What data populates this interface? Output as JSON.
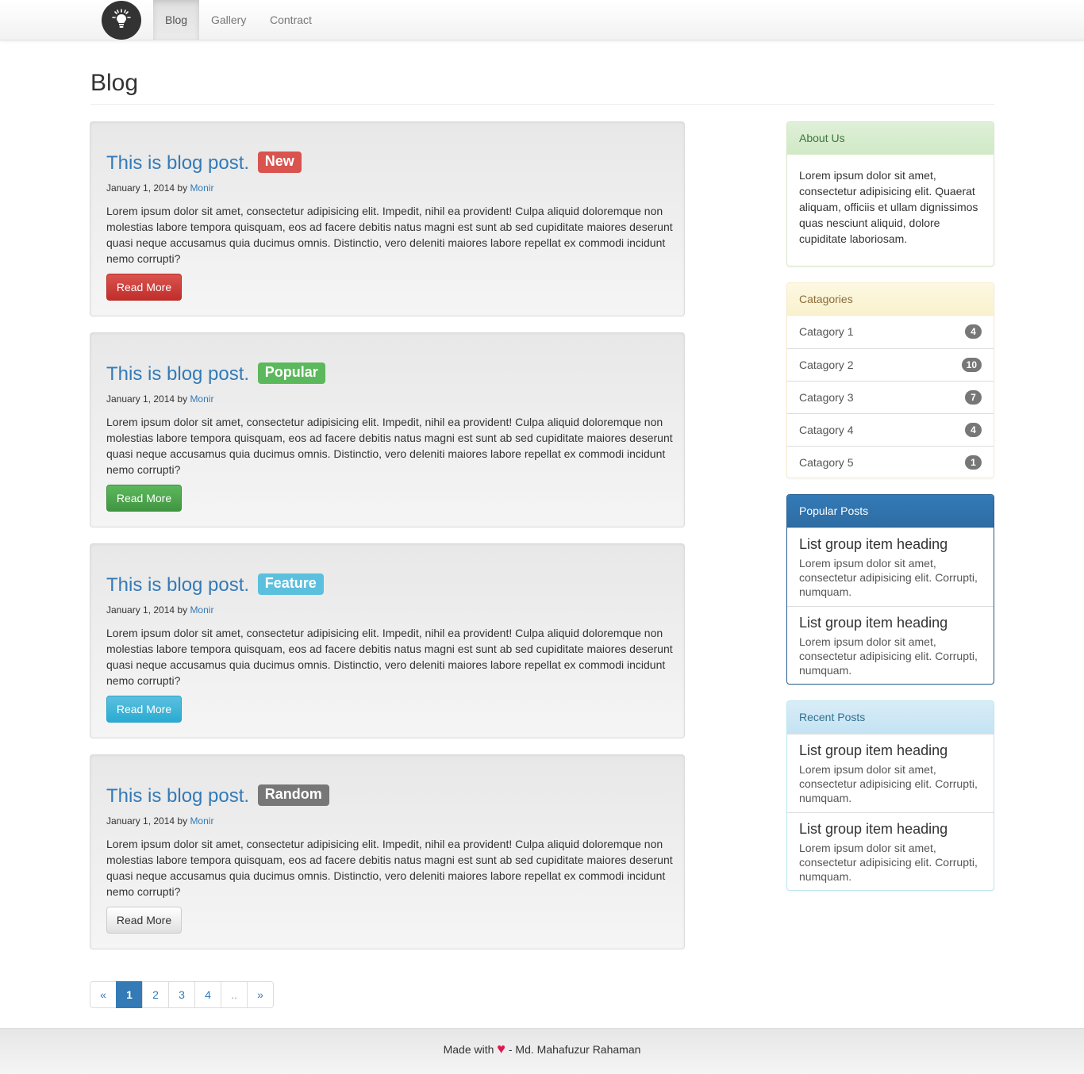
{
  "nav": {
    "logo_icon": "lightbulb-icon",
    "items": [
      {
        "label": "Blog"
      },
      {
        "label": "Gallery"
      },
      {
        "label": "Contract"
      }
    ]
  },
  "page": {
    "title": "Blog"
  },
  "posts": [
    {
      "title": "This is blog post.",
      "label": "New",
      "label_color": "#d9534f",
      "date": "January 1, 2014",
      "by": "by",
      "author": "Monir",
      "body": "Lorem ipsum dolor sit amet, consectetur adipisicing elit. Impedit, nihil ea provident! Culpa aliquid doloremque non molestias labore tempora quisquam, eos ad facere debitis natus magni est sunt ab sed cupiditate maiores deserunt quasi neque accusamus quia ducimus omnis. Distinctio, vero deleniti maiores labore repellat ex commodi incidunt nemo corrupti?",
      "button": "Read More"
    },
    {
      "title": "This is blog post.",
      "label": "Popular",
      "label_color": "#5cb85c",
      "date": "January 1, 2014",
      "by": "by",
      "author": "Monir",
      "body": "Lorem ipsum dolor sit amet, consectetur adipisicing elit. Impedit, nihil ea provident! Culpa aliquid doloremque non molestias labore tempora quisquam, eos ad facere debitis natus magni est sunt ab sed cupiditate maiores deserunt quasi neque accusamus quia ducimus omnis. Distinctio, vero deleniti maiores labore repellat ex commodi incidunt nemo corrupti?",
      "button": "Read More"
    },
    {
      "title": "This is blog post.",
      "label": "Feature",
      "label_color": "#5bc0de",
      "date": "January 1, 2014",
      "by": "by",
      "author": "Monir",
      "body": "Lorem ipsum dolor sit amet, consectetur adipisicing elit. Impedit, nihil ea provident! Culpa aliquid doloremque non molestias labore tempora quisquam, eos ad facere debitis natus magni est sunt ab sed cupiditate maiores deserunt quasi neque accusamus quia ducimus omnis. Distinctio, vero deleniti maiores labore repellat ex commodi incidunt nemo corrupti?",
      "button": "Read More"
    },
    {
      "title": "This is blog post.",
      "label": "Random",
      "label_color": "#777777",
      "date": "January 1, 2014",
      "by": "by",
      "author": "Monir",
      "body": "Lorem ipsum dolor sit amet, consectetur adipisicing elit. Impedit, nihil ea provident! Culpa aliquid doloremque non molestias labore tempora quisquam, eos ad facere debitis natus magni est sunt ab sed cupiditate maiores deserunt quasi neque accusamus quia ducimus omnis. Distinctio, vero deleniti maiores labore repellat ex commodi incidunt nemo corrupti?",
      "button": "Read More"
    }
  ],
  "pagination": {
    "prev": "«",
    "pages": [
      "1",
      "2",
      "3",
      "4",
      ".."
    ],
    "next": "»",
    "active": "1"
  },
  "sidebar": {
    "about": {
      "heading": "About Us",
      "body": "Lorem ipsum dolor sit amet, consectetur adipisicing elit. Quaerat aliquam, officiis et ullam dignissimos quas nesciunt aliquid, dolore cupiditate laboriosam."
    },
    "categories": {
      "heading": "Catagories",
      "items": [
        {
          "name": "Catagory 1",
          "count": "4"
        },
        {
          "name": "Catagory 2",
          "count": "10"
        },
        {
          "name": "Catagory 3",
          "count": "7"
        },
        {
          "name": "Catagory 4",
          "count": "4"
        },
        {
          "name": "Catagory 5",
          "count": "1"
        }
      ]
    },
    "popular": {
      "heading": "Popular Posts",
      "items": [
        {
          "heading": "List group item heading",
          "text": "Lorem ipsum dolor sit amet, consectetur adipisicing elit. Corrupti, numquam."
        },
        {
          "heading": "List group item heading",
          "text": "Lorem ipsum dolor sit amet, consectetur adipisicing elit. Corrupti, numquam."
        }
      ]
    },
    "recent": {
      "heading": "Recent Posts",
      "items": [
        {
          "heading": "List group item heading",
          "text": "Lorem ipsum dolor sit amet, consectetur adipisicing elit. Corrupti, numquam."
        },
        {
          "heading": "List group item heading",
          "text": "Lorem ipsum dolor sit amet, consectetur adipisicing elit. Corrupti, numquam."
        }
      ]
    }
  },
  "footer": {
    "prefix": "Made with",
    "heart": "♥",
    "suffix": "- Md. Mahafuzur Rahaman",
    "heart_color": "#e0174d"
  }
}
